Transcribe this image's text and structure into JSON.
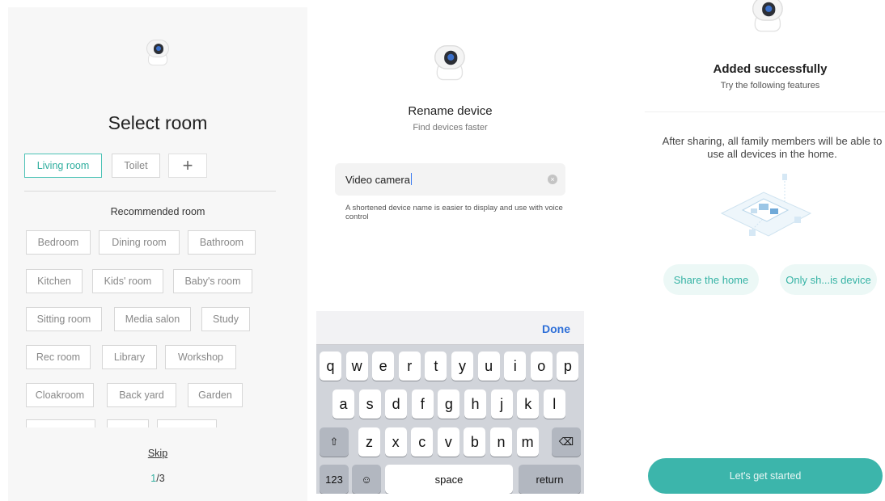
{
  "select_room": {
    "title": "Select room",
    "rooms": [
      "Living room",
      "Toilet"
    ],
    "recommended_heading": "Recommended room",
    "recommended": [
      [
        "Bedroom",
        "Dining room",
        "Bathroom"
      ],
      [
        "Kitchen",
        "Kids' room",
        "Baby's room"
      ],
      [
        "Sitting room",
        "Media salon",
        "Study"
      ],
      [
        "Rec room",
        "Library",
        "Workshop"
      ],
      [
        "Cloakroom",
        "Back yard",
        "Garden"
      ]
    ],
    "skip": "Skip",
    "page_current": "1",
    "page_total": "/3"
  },
  "rename": {
    "title": "Rename device",
    "subtitle": "Find devices faster",
    "value": "Video camera",
    "hint": "A shortened device name is easier to display and use with voice control",
    "done": "Done",
    "rows": [
      [
        "q",
        "w",
        "e",
        "r",
        "t",
        "y",
        "u",
        "i",
        "o",
        "p"
      ],
      [
        "a",
        "s",
        "d",
        "f",
        "g",
        "h",
        "j",
        "k",
        "l"
      ],
      [
        "z",
        "x",
        "c",
        "v",
        "b",
        "n",
        "m"
      ]
    ],
    "num_key": "123",
    "space_key": "space",
    "return_key": "return"
  },
  "added": {
    "title": "Added  successfully",
    "subtitle": "Try  the following features",
    "description": "After sharing, all family members will be able to use all devices in the home.",
    "share_home": "Share the home",
    "share_device": "Only sh...is device",
    "cta": "Let's get started"
  },
  "colors": {
    "accent": "#3cb5ab",
    "done": "#2e6fd8"
  },
  "icons": [
    "camera-icon",
    "plus-icon",
    "clear-icon",
    "shift-icon",
    "delete-icon",
    "emoji-icon",
    "home-illustration"
  ]
}
